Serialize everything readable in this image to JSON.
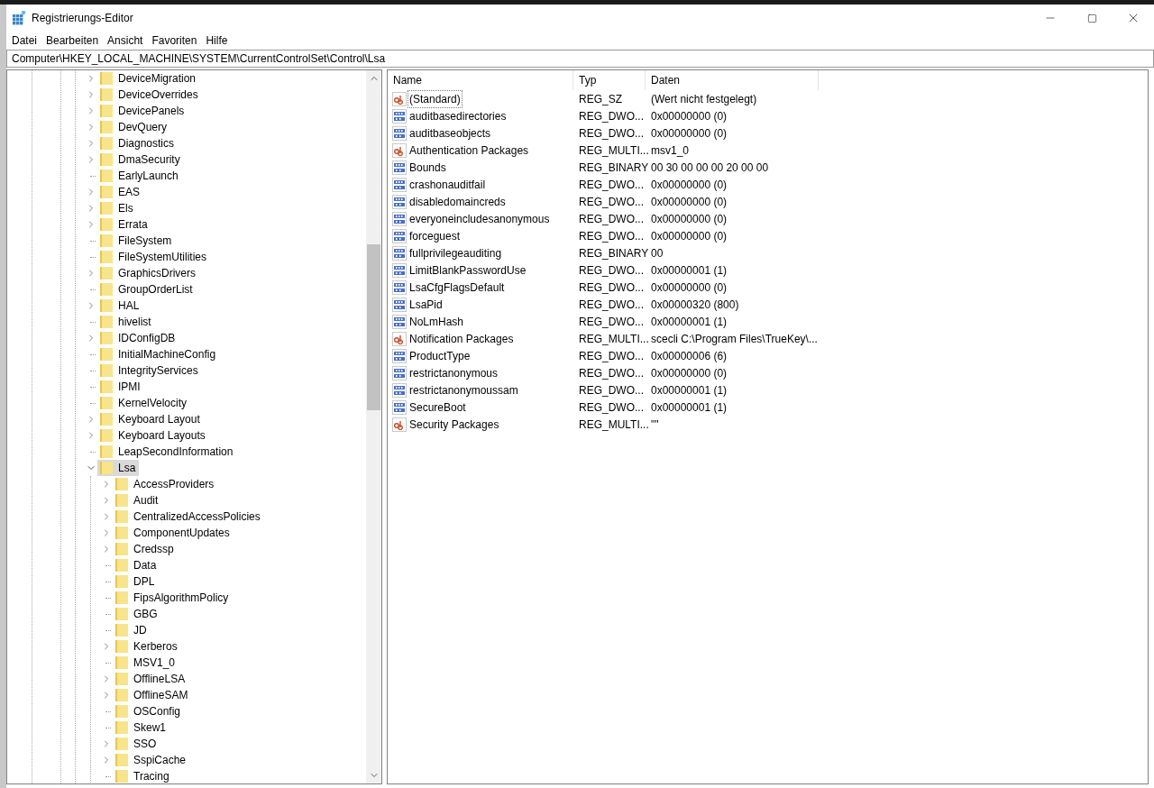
{
  "window": {
    "title": "Registrierungs-Editor"
  },
  "menu": [
    "Datei",
    "Bearbeiten",
    "Ansicht",
    "Favoriten",
    "Hilfe"
  ],
  "address": "Computer\\HKEY_LOCAL_MACHINE\\SYSTEM\\CurrentControlSet\\Control\\Lsa",
  "tree": [
    {
      "name": "DeviceMigration",
      "has_children": true,
      "expanded": false,
      "selected": false
    },
    {
      "name": "DeviceOverrides",
      "has_children": true,
      "expanded": false,
      "selected": false
    },
    {
      "name": "DevicePanels",
      "has_children": true,
      "expanded": false,
      "selected": false
    },
    {
      "name": "DevQuery",
      "has_children": true,
      "expanded": false,
      "selected": false
    },
    {
      "name": "Diagnostics",
      "has_children": true,
      "expanded": false,
      "selected": false
    },
    {
      "name": "DmaSecurity",
      "has_children": true,
      "expanded": false,
      "selected": false
    },
    {
      "name": "EarlyLaunch",
      "has_children": false,
      "expanded": false,
      "selected": false
    },
    {
      "name": "EAS",
      "has_children": true,
      "expanded": false,
      "selected": false
    },
    {
      "name": "Els",
      "has_children": true,
      "expanded": false,
      "selected": false
    },
    {
      "name": "Errata",
      "has_children": true,
      "expanded": false,
      "selected": false
    },
    {
      "name": "FileSystem",
      "has_children": false,
      "expanded": false,
      "selected": false
    },
    {
      "name": "FileSystemUtilities",
      "has_children": false,
      "expanded": false,
      "selected": false
    },
    {
      "name": "GraphicsDrivers",
      "has_children": true,
      "expanded": false,
      "selected": false
    },
    {
      "name": "GroupOrderList",
      "has_children": false,
      "expanded": false,
      "selected": false
    },
    {
      "name": "HAL",
      "has_children": true,
      "expanded": false,
      "selected": false
    },
    {
      "name": "hivelist",
      "has_children": false,
      "expanded": false,
      "selected": false
    },
    {
      "name": "IDConfigDB",
      "has_children": true,
      "expanded": false,
      "selected": false
    },
    {
      "name": "InitialMachineConfig",
      "has_children": false,
      "expanded": false,
      "selected": false
    },
    {
      "name": "IntegrityServices",
      "has_children": false,
      "expanded": false,
      "selected": false
    },
    {
      "name": "IPMI",
      "has_children": false,
      "expanded": false,
      "selected": false
    },
    {
      "name": "KernelVelocity",
      "has_children": false,
      "expanded": false,
      "selected": false
    },
    {
      "name": "Keyboard Layout",
      "has_children": true,
      "expanded": false,
      "selected": false
    },
    {
      "name": "Keyboard Layouts",
      "has_children": true,
      "expanded": false,
      "selected": false
    },
    {
      "name": "LeapSecondInformation",
      "has_children": false,
      "expanded": false,
      "selected": false
    },
    {
      "name": "Lsa",
      "has_children": true,
      "expanded": true,
      "selected": true,
      "children": [
        {
          "name": "AccessProviders",
          "has_children": true,
          "expanded": false,
          "selected": false
        },
        {
          "name": "Audit",
          "has_children": true,
          "expanded": false,
          "selected": false
        },
        {
          "name": "CentralizedAccessPolicies",
          "has_children": true,
          "expanded": false,
          "selected": false
        },
        {
          "name": "ComponentUpdates",
          "has_children": true,
          "expanded": false,
          "selected": false
        },
        {
          "name": "Credssp",
          "has_children": true,
          "expanded": false,
          "selected": false
        },
        {
          "name": "Data",
          "has_children": false,
          "expanded": false,
          "selected": false
        },
        {
          "name": "DPL",
          "has_children": false,
          "expanded": false,
          "selected": false
        },
        {
          "name": "FipsAlgorithmPolicy",
          "has_children": false,
          "expanded": false,
          "selected": false
        },
        {
          "name": "GBG",
          "has_children": false,
          "expanded": false,
          "selected": false
        },
        {
          "name": "JD",
          "has_children": false,
          "expanded": false,
          "selected": false
        },
        {
          "name": "Kerberos",
          "has_children": true,
          "expanded": false,
          "selected": false
        },
        {
          "name": "MSV1_0",
          "has_children": false,
          "expanded": false,
          "selected": false
        },
        {
          "name": "OfflineLSA",
          "has_children": true,
          "expanded": false,
          "selected": false
        },
        {
          "name": "OfflineSAM",
          "has_children": true,
          "expanded": false,
          "selected": false
        },
        {
          "name": "OSConfig",
          "has_children": false,
          "expanded": false,
          "selected": false
        },
        {
          "name": "Skew1",
          "has_children": false,
          "expanded": false,
          "selected": false
        },
        {
          "name": "SSO",
          "has_children": true,
          "expanded": false,
          "selected": false
        },
        {
          "name": "SspiCache",
          "has_children": true,
          "expanded": false,
          "selected": false
        },
        {
          "name": "Tracing",
          "has_children": false,
          "expanded": false,
          "selected": false
        }
      ]
    }
  ],
  "table": {
    "columns": [
      "Name",
      "Typ",
      "Daten"
    ],
    "rows": [
      {
        "kind": "string",
        "name": "(Standard)",
        "type": "REG_SZ",
        "data": "(Wert nicht festgelegt)",
        "focused": true
      },
      {
        "kind": "binary",
        "name": "auditbasedirectories",
        "type": "REG_DWO...",
        "data": "0x00000000 (0)",
        "focused": false
      },
      {
        "kind": "binary",
        "name": "auditbaseobjects",
        "type": "REG_DWO...",
        "data": "0x00000000 (0)",
        "focused": false
      },
      {
        "kind": "string",
        "name": "Authentication Packages",
        "type": "REG_MULTI...",
        "data": "msv1_0",
        "focused": false
      },
      {
        "kind": "binary",
        "name": "Bounds",
        "type": "REG_BINARY",
        "data": "00 30 00 00 00 20 00 00",
        "focused": false
      },
      {
        "kind": "binary",
        "name": "crashonauditfail",
        "type": "REG_DWO...",
        "data": "0x00000000 (0)",
        "focused": false
      },
      {
        "kind": "binary",
        "name": "disabledomaincreds",
        "type": "REG_DWO...",
        "data": "0x00000000 (0)",
        "focused": false
      },
      {
        "kind": "binary",
        "name": "everyoneincludesanonymous",
        "type": "REG_DWO...",
        "data": "0x00000000 (0)",
        "focused": false
      },
      {
        "kind": "binary",
        "name": "forceguest",
        "type": "REG_DWO...",
        "data": "0x00000000 (0)",
        "focused": false
      },
      {
        "kind": "binary",
        "name": "fullprivilegeauditing",
        "type": "REG_BINARY",
        "data": "00",
        "focused": false
      },
      {
        "kind": "binary",
        "name": "LimitBlankPasswordUse",
        "type": "REG_DWO...",
        "data": "0x00000001 (1)",
        "focused": false
      },
      {
        "kind": "binary",
        "name": "LsaCfgFlagsDefault",
        "type": "REG_DWO...",
        "data": "0x00000000 (0)",
        "focused": false
      },
      {
        "kind": "binary",
        "name": "LsaPid",
        "type": "REG_DWO...",
        "data": "0x00000320 (800)",
        "focused": false
      },
      {
        "kind": "binary",
        "name": "NoLmHash",
        "type": "REG_DWO...",
        "data": "0x00000001 (1)",
        "focused": false
      },
      {
        "kind": "string",
        "name": "Notification Packages",
        "type": "REG_MULTI...",
        "data": "scecli C:\\Program Files\\TrueKey\\...",
        "focused": false
      },
      {
        "kind": "binary",
        "name": "ProductType",
        "type": "REG_DWO...",
        "data": "0x00000006 (6)",
        "focused": false
      },
      {
        "kind": "binary",
        "name": "restrictanonymous",
        "type": "REG_DWO...",
        "data": "0x00000000 (0)",
        "focused": false
      },
      {
        "kind": "binary",
        "name": "restrictanonymoussam",
        "type": "REG_DWO...",
        "data": "0x00000001 (1)",
        "focused": false
      },
      {
        "kind": "binary",
        "name": "SecureBoot",
        "type": "REG_DWO...",
        "data": "0x00000001 (1)",
        "focused": false
      },
      {
        "kind": "string",
        "name": "Security Packages",
        "type": "REG_MULTI...",
        "data": "\"\"",
        "focused": false
      }
    ]
  }
}
